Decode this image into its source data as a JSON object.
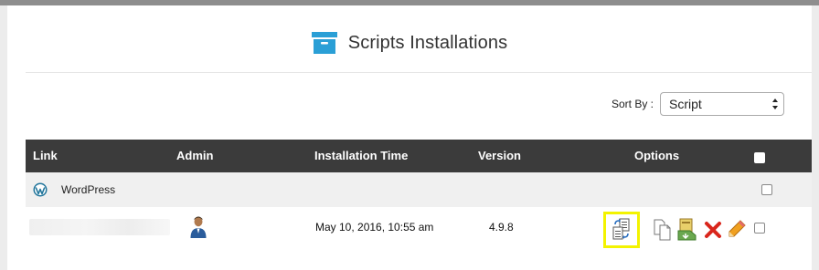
{
  "page": {
    "title": "Scripts Installations"
  },
  "sort": {
    "label": "Sort By :",
    "selected": "Script"
  },
  "table": {
    "columns": [
      "Link",
      "Admin",
      "Installation Time",
      "Version",
      "Options"
    ],
    "groups": [
      {
        "name": "WordPress",
        "icon": "wordpress-icon",
        "rows": [
          {
            "link": "",
            "admin_icon": "admin-user-icon",
            "installation_time": "May 10, 2016, 10:55 am",
            "version": "4.9.8",
            "options": [
              "clone-icon",
              "copy-icon",
              "backup-icon",
              "delete-icon",
              "edit-icon"
            ]
          }
        ]
      }
    ]
  },
  "colors": {
    "header_bg": "#3b3b3b",
    "accent_blue": "#2a9fd6",
    "highlight": "#f3f300",
    "delete_red": "#d9261c",
    "edit_orange": "#f0a020"
  }
}
